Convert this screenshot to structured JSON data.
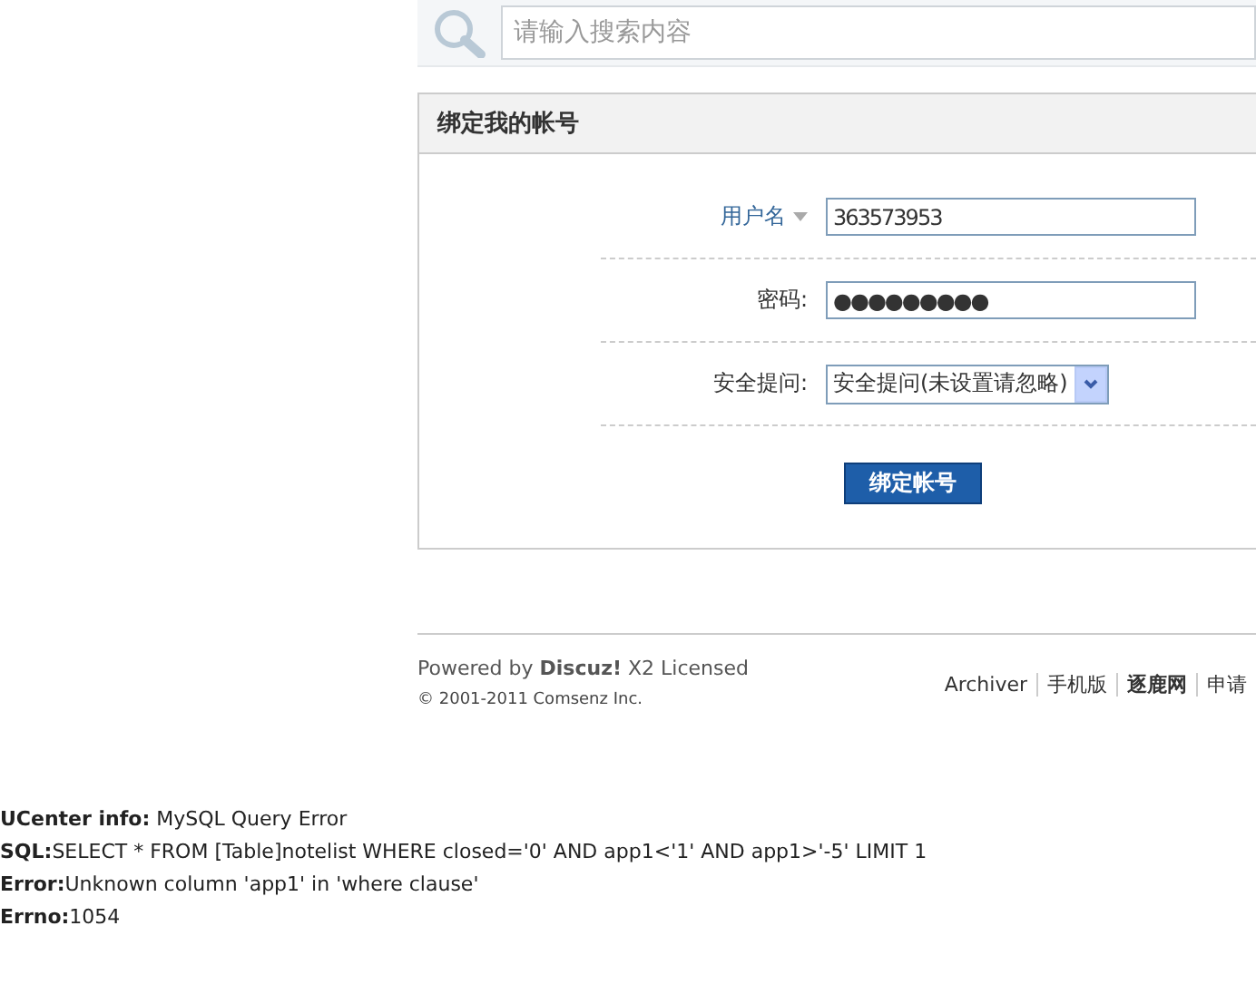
{
  "search": {
    "placeholder": "请输入搜索内容"
  },
  "panel": {
    "title": "绑定我的帐号",
    "fields": [
      {
        "kind": "text",
        "label": "用户名",
        "dropdown": true,
        "value": "363573953"
      },
      {
        "kind": "text",
        "label": "密码:",
        "value": "●●●●●●●●●"
      },
      {
        "kind": "select",
        "label": "安全提问:",
        "value": "安全提问(未设置请忽略)"
      }
    ],
    "submit": "绑定帐号"
  },
  "footer": {
    "powered": "Powered by **Discuz!** X2 Licensed",
    "copyright": "© 2001-2011 Comsenz Inc.",
    "links": [
      {
        "label": "Archiver",
        "bold": false
      },
      {
        "label": "手机版",
        "bold": false
      },
      {
        "label": "逐鹿网",
        "bold": true
      },
      {
        "label": "申请",
        "bold": false
      }
    ]
  },
  "error_lines": [
    "**UCenter info:** MySQL Query Error",
    "**SQL:**SELECT * FROM [Table]notelist WHERE closed='0' AND app1<'1' AND app1>'-5' LIMIT 1",
    "**Error:**Unknown column 'app1' in 'where clause'",
    "**Errno:**1054"
  ]
}
